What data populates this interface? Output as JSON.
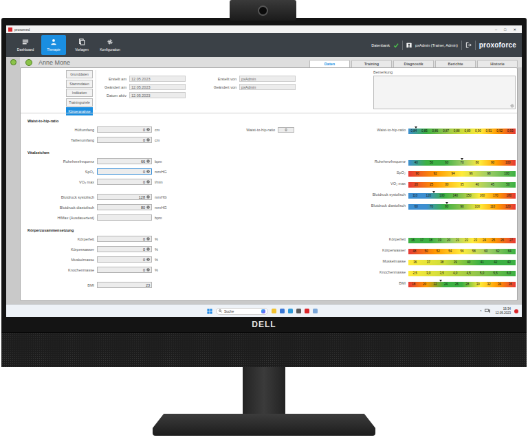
{
  "window": {
    "title": "proxomed",
    "controls": [
      "–",
      "□",
      "✕"
    ]
  },
  "toolbar": {
    "items": [
      {
        "label": "Dashboard",
        "selected": false
      },
      {
        "label": "Therapie",
        "selected": true
      },
      {
        "label": "Vorlagen",
        "selected": false
      },
      {
        "label": "Konfiguration",
        "selected": false
      }
    ]
  },
  "database": {
    "label": "Datenbank",
    "ok": true
  },
  "user": {
    "label": "pxAdmin (Trainer, Admin)"
  },
  "brand": "proxoforce",
  "patient": {
    "name": "Anne Mone"
  },
  "tabs": [
    {
      "label": "Daten",
      "selected": true
    },
    {
      "label": "Training",
      "selected": false
    },
    {
      "label": "Diagnostik",
      "selected": false
    },
    {
      "label": "Berichte",
      "selected": false
    },
    {
      "label": "Historie",
      "selected": false
    }
  ],
  "subnav": [
    {
      "label": "Grunddaten",
      "selected": false
    },
    {
      "label": "Stammdaten",
      "selected": false
    },
    {
      "label": "Indikation",
      "selected": false
    },
    {
      "label": "Trainingsziele",
      "selected": false
    },
    {
      "label": "Körperanalyse",
      "selected": true
    }
  ],
  "meta_left": [
    {
      "label": "Erstellt am",
      "value": "12.05.2023"
    },
    {
      "label": "Geändert am",
      "value": "12.05.2023"
    },
    {
      "label": "Datum aktiv",
      "value": "12.05.2023"
    }
  ],
  "meta_right": [
    {
      "label": "Erstellt von",
      "value": "pxAdmin"
    },
    {
      "label": "Geändert von",
      "value": "pxAdmin"
    }
  ],
  "remark": {
    "label": "Bemerkung"
  },
  "sections": [
    {
      "title": "Waist-to-hip-ratio",
      "groups": [
        [
          {
            "label": "Hüftumfang",
            "value": "0",
            "unit": "cm",
            "clearable": true,
            "focused": false
          },
          {
            "label": "Taillenumfang",
            "value": "0",
            "unit": "cm",
            "clearable": true,
            "focused": false
          }
        ]
      ],
      "ratio": {
        "label": "Waist-to-hip-ratio",
        "value": "0"
      },
      "scales": [
        {
          "label": "Waist-to-hip-ratio",
          "ticks": [
            "0,84",
            "0,85",
            "0,86",
            "0,87",
            "0,88",
            "0,89",
            "0,90",
            "0,91",
            "0,92",
            "0,93"
          ],
          "colors": [
            "#3d8fd1",
            "#3cb043",
            "#8bc34a",
            "#cddc39",
            "#ffeb3b",
            "#ff9800",
            "#e53935"
          ],
          "marker_shown": true,
          "level": 0.07
        }
      ]
    },
    {
      "title": "Vitalzeichen",
      "groups": [
        [
          {
            "label": "Ruheherzfrequenz",
            "value": "66",
            "unit": "bpm",
            "clearable": true,
            "focused": false
          },
          {
            "label": "SpO₂",
            "value": "0",
            "unit": "mmHG",
            "clearable": true,
            "focused": true
          },
          {
            "label": "VO₂ max",
            "value": "0",
            "unit": "l/min",
            "clearable": true,
            "focused": false
          }
        ],
        [
          {
            "label": "Blutdruck systolisch",
            "value": "128",
            "unit": "mmHG",
            "clearable": true,
            "focused": false
          },
          {
            "label": "Blutdruck diastolisch",
            "value": "80",
            "unit": "mmHG",
            "clearable": true,
            "focused": false
          },
          {
            "label": "HfMax (Ausdauertest)",
            "unit": "bpm",
            "clearable": false,
            "focused": false
          }
        ]
      ],
      "scales": [
        {
          "label": "Ruheherzfrequenz",
          "ticks": [
            "40",
            "50",
            "60",
            "70",
            "80",
            "90",
            "100"
          ],
          "colors": [
            "#3d8fd1",
            "#3cb043",
            "#3cb043",
            "#9ccc65",
            "#ffeb3b",
            "#ff9800",
            "#e53935"
          ],
          "marker_shown": true,
          "level": 0.5
        },
        {
          "label": "SpO₂",
          "ticks": [
            "90",
            "92",
            "94",
            "96",
            "98",
            "100"
          ],
          "colors": [
            "#e53935",
            "#ff9800",
            "#ffeb3b",
            "#9ccc65",
            "#3cb043"
          ],
          "marker_shown": false,
          "level": 0
        },
        {
          "label": "VO₂ max",
          "ticks": [
            "20",
            "25",
            "30",
            "35",
            "40",
            "45",
            "50"
          ],
          "colors": [
            "#e53935",
            "#ff9800",
            "#ffeb3b",
            "#9ccc65",
            "#3cb043"
          ],
          "marker_shown": false,
          "level": 0
        },
        {
          "label": "Blutdruck systolisch",
          "ticks": [
            "110",
            "120",
            "130",
            "140",
            "150",
            "160",
            "170",
            "180"
          ],
          "colors": [
            "#3d8fd1",
            "#3d8fd1",
            "#3cb043",
            "#8bc34a",
            "#ffeb3b",
            "#ff9800",
            "#e53935"
          ],
          "marker_shown": true,
          "level": 0.24
        },
        {
          "label": "Blutdruck diastolisch",
          "ticks": [
            "60",
            "70",
            "80",
            "90",
            "100",
            "110",
            "120"
          ],
          "colors": [
            "#3d8fd1",
            "#3d8fd1",
            "#3cb043",
            "#8bc34a",
            "#ffeb3b",
            "#ff9800",
            "#e53935"
          ],
          "marker_shown": true,
          "level": 0.36
        }
      ]
    },
    {
      "title": "Körperzusammensetzung",
      "groups": [
        [
          {
            "label": "Körperfett",
            "value": "0",
            "unit": "%",
            "clearable": true,
            "focused": false
          },
          {
            "label": "Körperwasser",
            "value": "0",
            "unit": "%",
            "clearable": true,
            "focused": false
          },
          {
            "label": "Muskelmasse",
            "value": "0",
            "unit": "%",
            "clearable": true,
            "focused": false
          },
          {
            "label": "Knochenmasse",
            "value": "0",
            "unit": "%",
            "clearable": true,
            "focused": false
          }
        ],
        [
          {
            "label": "BMI",
            "value": "23",
            "clearable": false,
            "focused": false
          }
        ]
      ],
      "scales": [
        {
          "label": "Körperfett",
          "ticks": [
            "16",
            "17",
            "18",
            "19",
            "20",
            "21",
            "22",
            "23",
            "24",
            "25",
            "26",
            "27"
          ],
          "colors": [
            "#3cb043",
            "#3cb043",
            "#9ccc65",
            "#ffeb3b",
            "#ff9800",
            "#e53935"
          ],
          "marker_shown": false,
          "level": 0
        },
        {
          "label": "Körperwasser",
          "ticks": [
            "48",
            "50",
            "52",
            "54",
            "56",
            "58",
            "60",
            "62",
            "64"
          ],
          "colors": [
            "#e53935",
            "#ff9800",
            "#ffeb3b",
            "#9ccc65",
            "#3cb043"
          ],
          "marker_shown": false,
          "level": 0
        },
        {
          "label": "Muskelmasse",
          "ticks": [
            "36",
            "37",
            "38",
            "39",
            "40",
            "41",
            "42",
            "43"
          ],
          "colors": [
            "#ffeb3b",
            "#cddc39",
            "#3cb043",
            "#3cb043"
          ],
          "marker_shown": false,
          "level": 0
        },
        {
          "label": "Knochenmasse",
          "ticks": [
            "2,5",
            "3,0",
            "3,5",
            "4,0",
            "4,5",
            "5,0",
            "5,5",
            "6,0"
          ],
          "colors": [
            "#ffeb3b",
            "#cddc39",
            "#8bc34a",
            "#3cb043"
          ],
          "marker_shown": false,
          "level": 0
        },
        {
          "label": "BMI",
          "ticks": [
            "18",
            "20",
            "22",
            "24",
            "26",
            "28",
            "30",
            "32",
            "34",
            "36"
          ],
          "colors": [
            "#e53935",
            "#ff9800",
            "#3cb043",
            "#3cb043",
            "#ffeb3b",
            "#ff9800",
            "#e53935"
          ],
          "marker_shown": true,
          "level": 0.3
        }
      ]
    }
  ],
  "taskbar": {
    "search": "Suche",
    "chevron": "^",
    "time": "15:34",
    "date": "12.05.2023",
    "notification": true
  },
  "monitor": {
    "brand": "DELL"
  }
}
